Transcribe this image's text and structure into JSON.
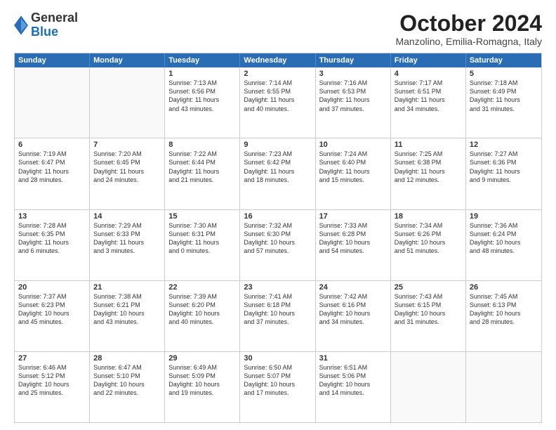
{
  "logo": {
    "general": "General",
    "blue": "Blue"
  },
  "title": "October 2024",
  "subtitle": "Manzolino, Emilia-Romagna, Italy",
  "header_days": [
    "Sunday",
    "Monday",
    "Tuesday",
    "Wednesday",
    "Thursday",
    "Friday",
    "Saturday"
  ],
  "rows": [
    [
      {
        "day": "",
        "lines": []
      },
      {
        "day": "",
        "lines": []
      },
      {
        "day": "1",
        "lines": [
          "Sunrise: 7:13 AM",
          "Sunset: 6:56 PM",
          "Daylight: 11 hours",
          "and 43 minutes."
        ]
      },
      {
        "day": "2",
        "lines": [
          "Sunrise: 7:14 AM",
          "Sunset: 6:55 PM",
          "Daylight: 11 hours",
          "and 40 minutes."
        ]
      },
      {
        "day": "3",
        "lines": [
          "Sunrise: 7:16 AM",
          "Sunset: 6:53 PM",
          "Daylight: 11 hours",
          "and 37 minutes."
        ]
      },
      {
        "day": "4",
        "lines": [
          "Sunrise: 7:17 AM",
          "Sunset: 6:51 PM",
          "Daylight: 11 hours",
          "and 34 minutes."
        ]
      },
      {
        "day": "5",
        "lines": [
          "Sunrise: 7:18 AM",
          "Sunset: 6:49 PM",
          "Daylight: 11 hours",
          "and 31 minutes."
        ]
      }
    ],
    [
      {
        "day": "6",
        "lines": [
          "Sunrise: 7:19 AM",
          "Sunset: 6:47 PM",
          "Daylight: 11 hours",
          "and 28 minutes."
        ]
      },
      {
        "day": "7",
        "lines": [
          "Sunrise: 7:20 AM",
          "Sunset: 6:45 PM",
          "Daylight: 11 hours",
          "and 24 minutes."
        ]
      },
      {
        "day": "8",
        "lines": [
          "Sunrise: 7:22 AM",
          "Sunset: 6:44 PM",
          "Daylight: 11 hours",
          "and 21 minutes."
        ]
      },
      {
        "day": "9",
        "lines": [
          "Sunrise: 7:23 AM",
          "Sunset: 6:42 PM",
          "Daylight: 11 hours",
          "and 18 minutes."
        ]
      },
      {
        "day": "10",
        "lines": [
          "Sunrise: 7:24 AM",
          "Sunset: 6:40 PM",
          "Daylight: 11 hours",
          "and 15 minutes."
        ]
      },
      {
        "day": "11",
        "lines": [
          "Sunrise: 7:25 AM",
          "Sunset: 6:38 PM",
          "Daylight: 11 hours",
          "and 12 minutes."
        ]
      },
      {
        "day": "12",
        "lines": [
          "Sunrise: 7:27 AM",
          "Sunset: 6:36 PM",
          "Daylight: 11 hours",
          "and 9 minutes."
        ]
      }
    ],
    [
      {
        "day": "13",
        "lines": [
          "Sunrise: 7:28 AM",
          "Sunset: 6:35 PM",
          "Daylight: 11 hours",
          "and 6 minutes."
        ]
      },
      {
        "day": "14",
        "lines": [
          "Sunrise: 7:29 AM",
          "Sunset: 6:33 PM",
          "Daylight: 11 hours",
          "and 3 minutes."
        ]
      },
      {
        "day": "15",
        "lines": [
          "Sunrise: 7:30 AM",
          "Sunset: 6:31 PM",
          "Daylight: 11 hours",
          "and 0 minutes."
        ]
      },
      {
        "day": "16",
        "lines": [
          "Sunrise: 7:32 AM",
          "Sunset: 6:30 PM",
          "Daylight: 10 hours",
          "and 57 minutes."
        ]
      },
      {
        "day": "17",
        "lines": [
          "Sunrise: 7:33 AM",
          "Sunset: 6:28 PM",
          "Daylight: 10 hours",
          "and 54 minutes."
        ]
      },
      {
        "day": "18",
        "lines": [
          "Sunrise: 7:34 AM",
          "Sunset: 6:26 PM",
          "Daylight: 10 hours",
          "and 51 minutes."
        ]
      },
      {
        "day": "19",
        "lines": [
          "Sunrise: 7:36 AM",
          "Sunset: 6:24 PM",
          "Daylight: 10 hours",
          "and 48 minutes."
        ]
      }
    ],
    [
      {
        "day": "20",
        "lines": [
          "Sunrise: 7:37 AM",
          "Sunset: 6:23 PM",
          "Daylight: 10 hours",
          "and 45 minutes."
        ]
      },
      {
        "day": "21",
        "lines": [
          "Sunrise: 7:38 AM",
          "Sunset: 6:21 PM",
          "Daylight: 10 hours",
          "and 43 minutes."
        ]
      },
      {
        "day": "22",
        "lines": [
          "Sunrise: 7:39 AM",
          "Sunset: 6:20 PM",
          "Daylight: 10 hours",
          "and 40 minutes."
        ]
      },
      {
        "day": "23",
        "lines": [
          "Sunrise: 7:41 AM",
          "Sunset: 6:18 PM",
          "Daylight: 10 hours",
          "and 37 minutes."
        ]
      },
      {
        "day": "24",
        "lines": [
          "Sunrise: 7:42 AM",
          "Sunset: 6:16 PM",
          "Daylight: 10 hours",
          "and 34 minutes."
        ]
      },
      {
        "day": "25",
        "lines": [
          "Sunrise: 7:43 AM",
          "Sunset: 6:15 PM",
          "Daylight: 10 hours",
          "and 31 minutes."
        ]
      },
      {
        "day": "26",
        "lines": [
          "Sunrise: 7:45 AM",
          "Sunset: 6:13 PM",
          "Daylight: 10 hours",
          "and 28 minutes."
        ]
      }
    ],
    [
      {
        "day": "27",
        "lines": [
          "Sunrise: 6:46 AM",
          "Sunset: 5:12 PM",
          "Daylight: 10 hours",
          "and 25 minutes."
        ]
      },
      {
        "day": "28",
        "lines": [
          "Sunrise: 6:47 AM",
          "Sunset: 5:10 PM",
          "Daylight: 10 hours",
          "and 22 minutes."
        ]
      },
      {
        "day": "29",
        "lines": [
          "Sunrise: 6:49 AM",
          "Sunset: 5:09 PM",
          "Daylight: 10 hours",
          "and 19 minutes."
        ]
      },
      {
        "day": "30",
        "lines": [
          "Sunrise: 6:50 AM",
          "Sunset: 5:07 PM",
          "Daylight: 10 hours",
          "and 17 minutes."
        ]
      },
      {
        "day": "31",
        "lines": [
          "Sunrise: 6:51 AM",
          "Sunset: 5:06 PM",
          "Daylight: 10 hours",
          "and 14 minutes."
        ]
      },
      {
        "day": "",
        "lines": []
      },
      {
        "day": "",
        "lines": []
      }
    ]
  ]
}
